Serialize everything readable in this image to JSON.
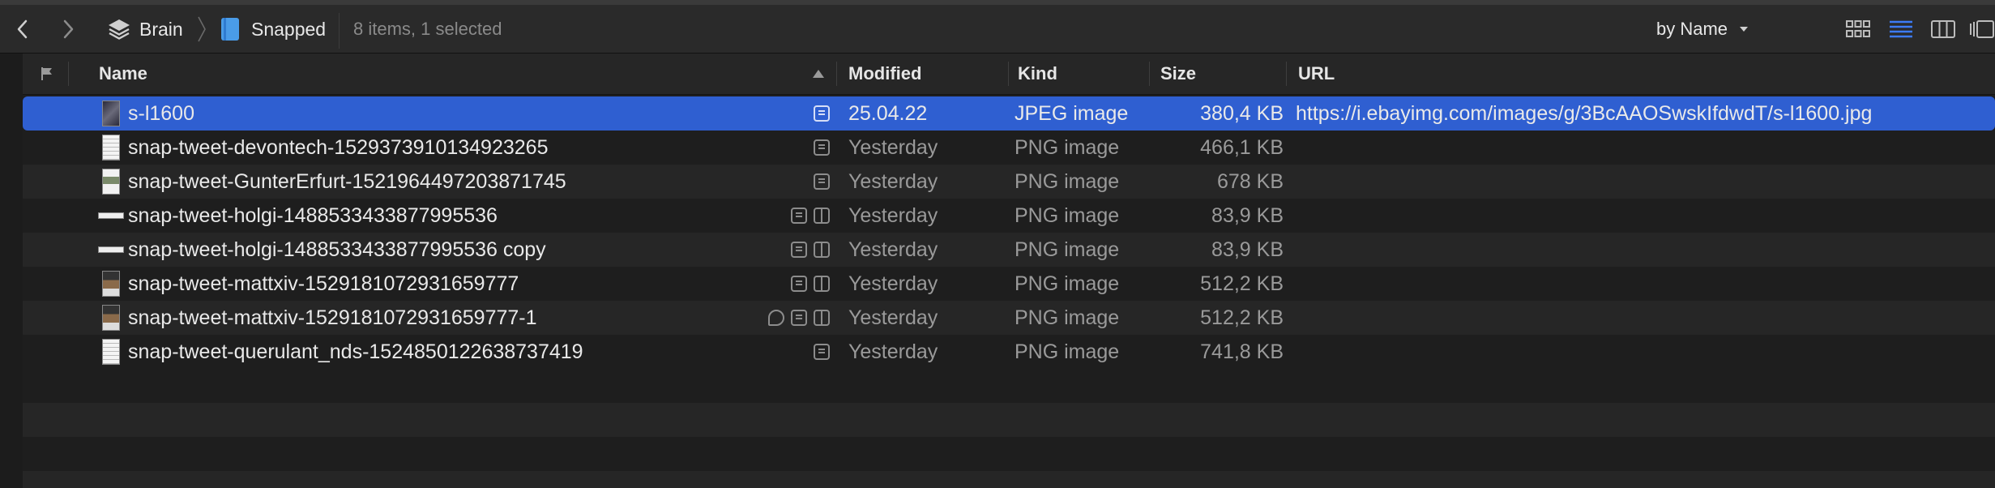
{
  "toolbar": {
    "breadcrumb": [
      {
        "label": "Brain",
        "icon": "layers-icon"
      },
      {
        "label": "Snapped",
        "icon": "book-icon"
      }
    ],
    "status": "8 items, 1 selected",
    "sort_label": "by Name",
    "view_modes": [
      "icon-view-icon",
      "list-view-icon",
      "column-view-icon",
      "cover-flow-icon"
    ],
    "active_view": "list-view-icon"
  },
  "columns": {
    "flag": "flag-icon",
    "name": "Name",
    "modified": "Modified",
    "kind": "Kind",
    "size": "Size",
    "url": "URL"
  },
  "rows": [
    {
      "name": "s-l1600",
      "modified": "25.04.22",
      "kind": "JPEG image",
      "size": "380,4 KB",
      "url": "https://i.ebayimg.com/images/g/3BcAAOSwskIfdwdT/s-l1600.jpg",
      "selected": true
    },
    {
      "name": "snap-tweet-devontech-1529373910134923265",
      "modified": "Yesterday",
      "kind": "PNG image",
      "size": "466,1 KB",
      "url": ""
    },
    {
      "name": "snap-tweet-GunterErfurt-1521964497203871745",
      "modified": "Yesterday",
      "kind": "PNG image",
      "size": "678 KB",
      "url": ""
    },
    {
      "name": "snap-tweet-holgi-1488533433877995536",
      "modified": "Yesterday",
      "kind": "PNG image",
      "size": "83,9 KB",
      "url": ""
    },
    {
      "name": "snap-tweet-holgi-1488533433877995536 copy",
      "modified": "Yesterday",
      "kind": "PNG image",
      "size": "83,9 KB",
      "url": ""
    },
    {
      "name": "snap-tweet-mattxiv-1529181072931659777",
      "modified": "Yesterday",
      "kind": "PNG image",
      "size": "512,2 KB",
      "url": ""
    },
    {
      "name": "snap-tweet-mattxiv-1529181072931659777-1",
      "modified": "Yesterday",
      "kind": "PNG image",
      "size": "512,2 KB",
      "url": ""
    },
    {
      "name": "snap-tweet-querulant_nds-1524850122638737419",
      "modified": "Yesterday",
      "kind": "PNG image",
      "size": "741,8 KB",
      "url": ""
    }
  ],
  "colors": {
    "selection": "#2f5fd1",
    "list_view_active": "#3d7bf5"
  }
}
